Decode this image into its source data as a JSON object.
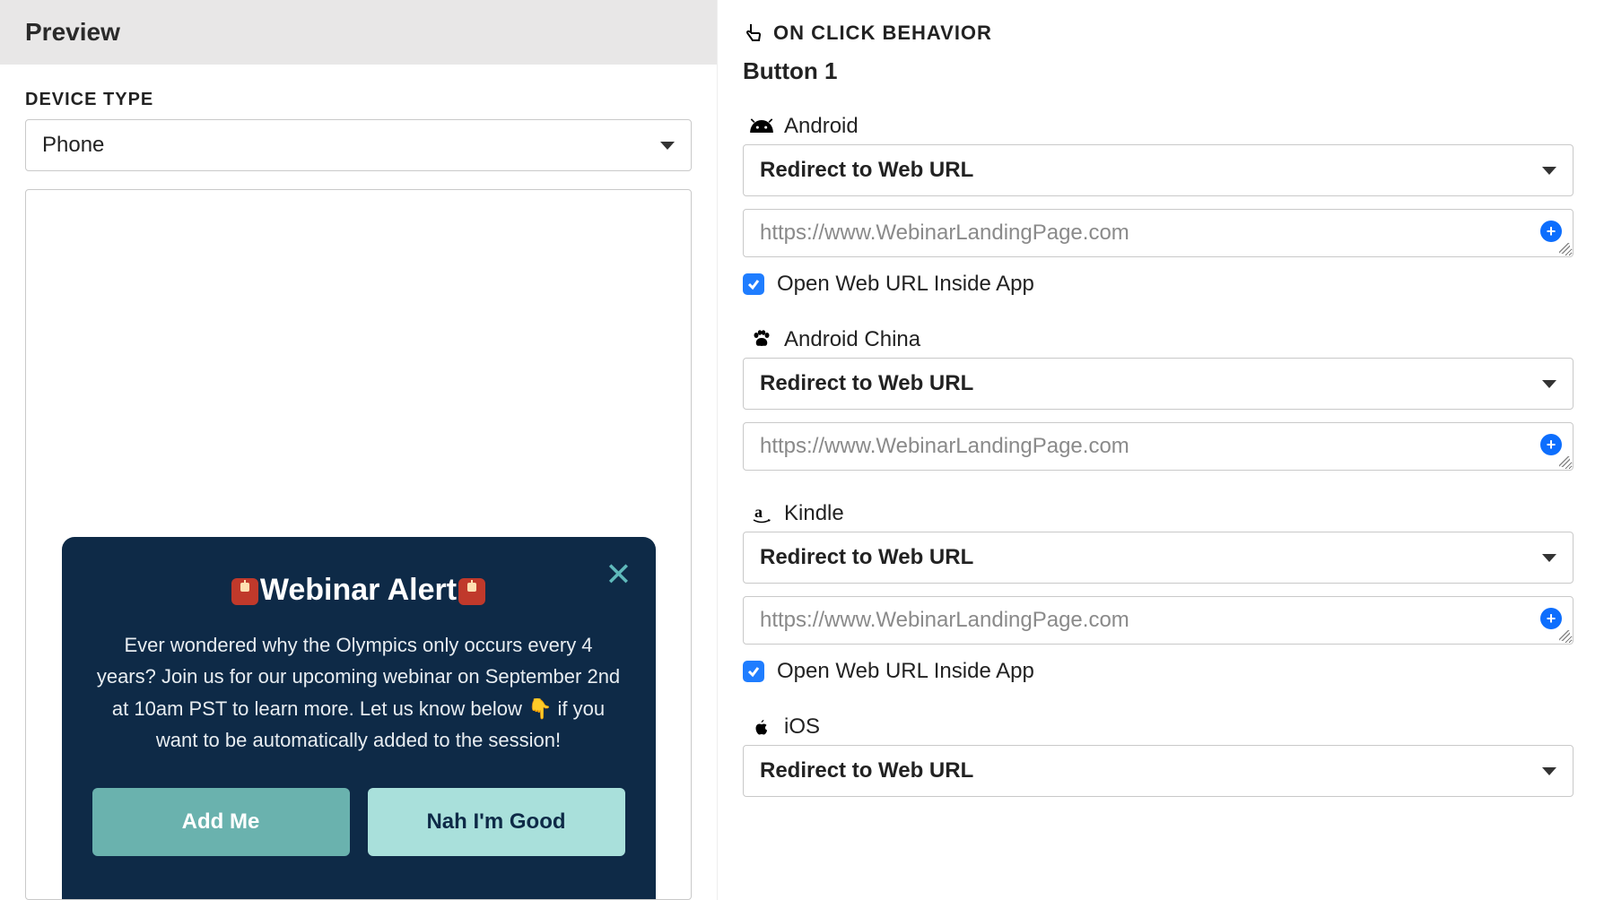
{
  "left": {
    "header": "Preview",
    "deviceTypeLabel": "DEVICE TYPE",
    "deviceTypeValue": "Phone",
    "modal": {
      "title": "Webinar Alert",
      "body": "Ever wondered why the Olympics only occurs every 4 years? Join us for our upcoming webinar on September 2nd at 10am PST to learn more. Let us know below 👇 if you want to be automatically added to the session!",
      "button1": "Add Me",
      "button2": "Nah I'm Good"
    }
  },
  "right": {
    "sectionTitle": "ON CLICK BEHAVIOR",
    "buttonLabel": "Button 1",
    "openInsideLabel": "Open Web URL Inside App",
    "platforms": [
      {
        "name": "Android",
        "icon": "android",
        "action": "Redirect to Web URL",
        "url": "https://www.WebinarLandingPage.com",
        "showCheckbox": true,
        "checked": true
      },
      {
        "name": "Android China",
        "icon": "paw",
        "action": "Redirect to Web URL",
        "url": "https://www.WebinarLandingPage.com",
        "showCheckbox": false,
        "checked": false
      },
      {
        "name": "Kindle",
        "icon": "amazon",
        "action": "Redirect to Web URL",
        "url": "https://www.WebinarLandingPage.com",
        "showCheckbox": true,
        "checked": true
      },
      {
        "name": "iOS",
        "icon": "apple",
        "action": "Redirect to Web URL",
        "url": "",
        "showCheckbox": false,
        "checked": false
      }
    ]
  }
}
